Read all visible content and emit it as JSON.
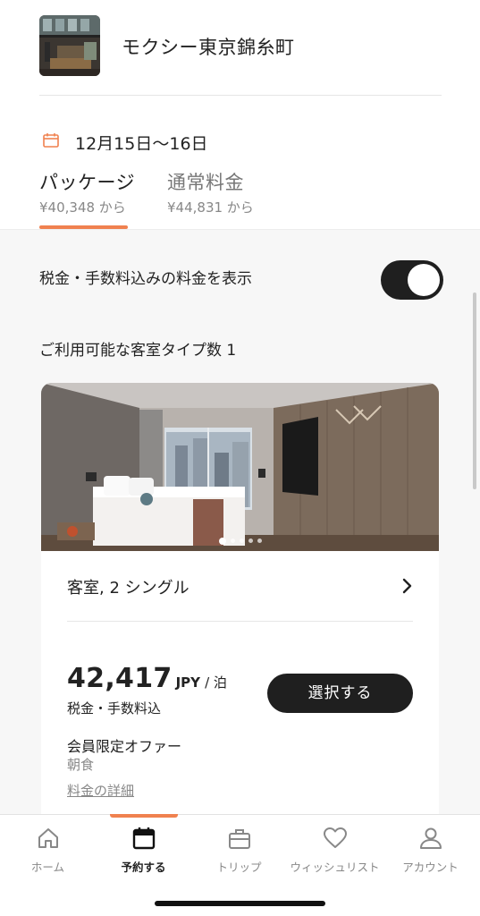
{
  "hotel": {
    "name": "モクシー東京錦糸町"
  },
  "dates": {
    "text": "12月15日～16日"
  },
  "tabs": [
    {
      "title": "パッケージ",
      "price": "¥40,348 から",
      "active": true
    },
    {
      "title": "通常料金",
      "price": "¥44,831 から",
      "active": false
    }
  ],
  "tax_toggle": {
    "label": "税金・手数料込みの料金を表示",
    "on": true
  },
  "room_count_label": "ご利用可能な客室タイプ数 1",
  "room": {
    "type": "客室, 2 シングル",
    "photo_count": 5,
    "photo_index": 1,
    "price_amount": "42,417",
    "price_unit": "JPY",
    "price_per": "/ 泊",
    "price_note": "税金・手数料込",
    "select_label": "選択する",
    "offer_title": "会員限定オファー",
    "offer_sub": "朝食",
    "rate_details_link": "料金の詳細"
  },
  "bottom_nav": [
    {
      "label": "ホーム",
      "icon": "home-icon",
      "active": false
    },
    {
      "label": "予約する",
      "icon": "calendar-icon",
      "active": true
    },
    {
      "label": "トリップ",
      "icon": "suitcase-icon",
      "active": false
    },
    {
      "label": "ウィッシュリスト",
      "icon": "heart-icon",
      "active": false
    },
    {
      "label": "アカウント",
      "icon": "person-icon",
      "active": false
    }
  ],
  "colors": {
    "accent": "#f0814f",
    "dark": "#1f1f1f",
    "muted": "#888888"
  }
}
